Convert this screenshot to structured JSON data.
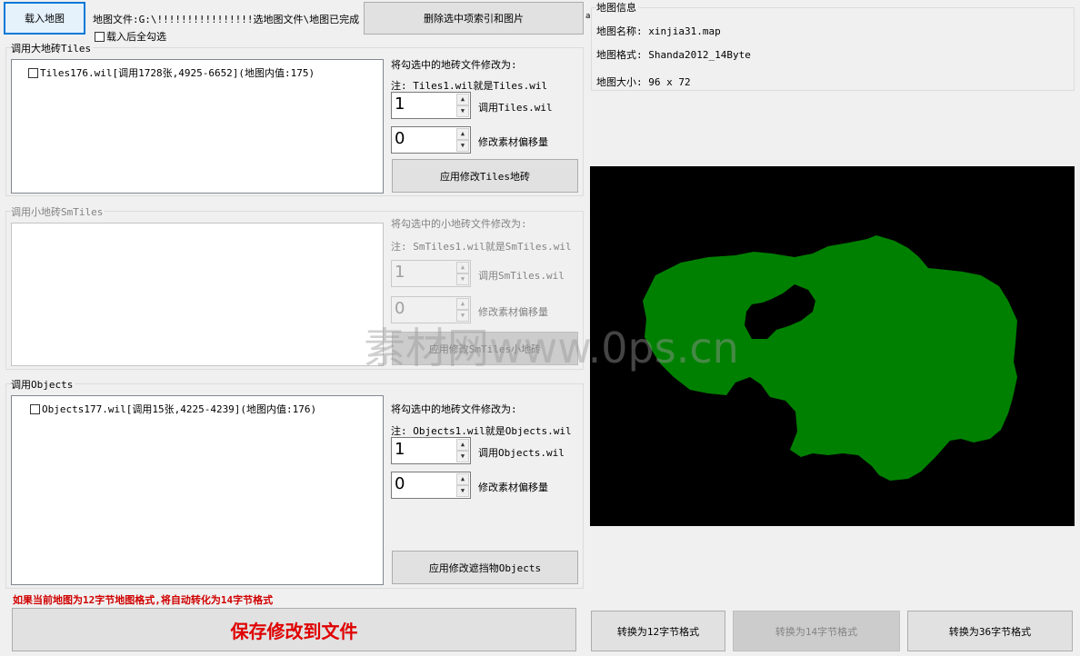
{
  "top": {
    "load_button": "载入地图",
    "map_file_label": "地图文件:G:\\!!!!!!!!!!!!!!!!选地图文件\\地图已完成",
    "trailing_char": "a",
    "delete_button": "删除选中项索引和图片",
    "select_all_checkbox": "载入后全勾选"
  },
  "tiles_group": {
    "title": "调用大地砖Tiles",
    "list_item": "Tiles176.wil[调用1728张,4925-6652](地图内值:175)",
    "modify_label": "将勾选中的地砖文件修改为:",
    "note": "注: Tiles1.wil就是Tiles.wil",
    "spin1_value": "1",
    "spin1_label": "调用Tiles.wil",
    "spin2_value": "0",
    "spin2_label": "修改素材偏移量",
    "apply_button": "应用修改Tiles地砖"
  },
  "smtiles_group": {
    "title": "调用小地砖SmTiles",
    "modify_label": "将勾选中的小地砖文件修改为:",
    "note": "注: SmTiles1.wil就是SmTiles.wil",
    "spin1_value": "1",
    "spin1_label": "调用SmTiles.wil",
    "spin2_value": "0",
    "spin2_label": "修改素材偏移量",
    "apply_button": "应用修改SmTiles小地砖"
  },
  "objects_group": {
    "title": "调用Objects",
    "list_item": "Objects177.wil[调用15张,4225-4239](地图内值:176)",
    "modify_label": "将勾选中的地砖文件修改为:",
    "note": "注: Objects1.wil就是Objects.wil",
    "spin1_value": "1",
    "spin1_label": "调用Objects.wil",
    "spin2_value": "0",
    "spin2_label": "修改素材偏移量",
    "apply_button": "应用修改遮挡物Objects"
  },
  "map_info": {
    "title": "地图信息",
    "name_label": "地图名称: xinjia31.map",
    "format_label": "地图格式: Shanda2012_14Byte",
    "size_label": "地图大小: 96 x 72"
  },
  "bottom": {
    "warning": "如果当前地图为12字节地图格式,将自动转化为14字节格式",
    "save_button": "保存修改到文件",
    "convert12": "转换为12字节格式",
    "convert14": "转换为14字节格式",
    "convert36": "转换为36字节格式"
  },
  "watermark": "素材网www.0ps.cn",
  "colors": {
    "map_background": "#000000",
    "map_land": "#008000",
    "warning_text": "#d00000",
    "save_text": "#e00000"
  }
}
